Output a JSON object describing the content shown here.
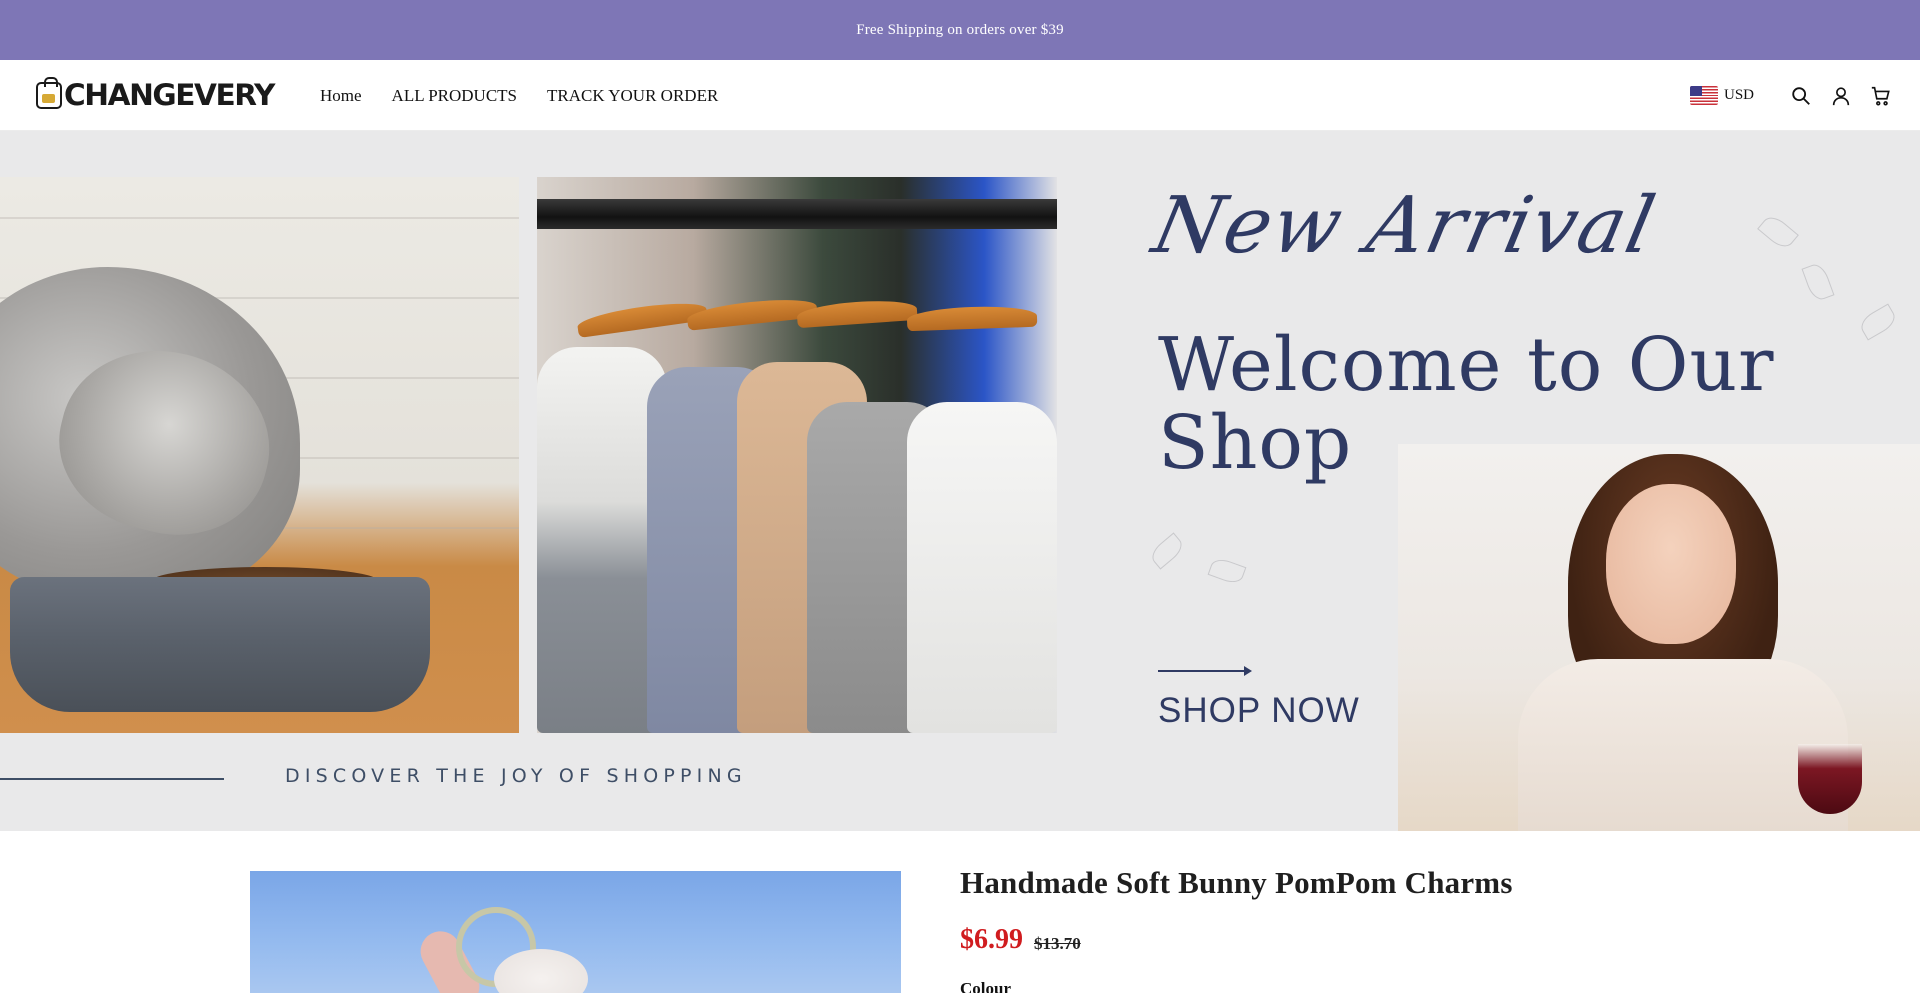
{
  "announcement": {
    "text": "Free Shipping on orders over $39"
  },
  "header": {
    "logo": "CHANGEVERY",
    "nav": [
      {
        "label": "Home"
      },
      {
        "label": "ALL PRODUCTS"
      },
      {
        "label": "TRACK YOUR ORDER"
      }
    ],
    "currency": {
      "code": "USD",
      "flag_icon": "us-flag-icon"
    },
    "icons": [
      "search-icon",
      "account-icon",
      "cart-icon"
    ]
  },
  "hero": {
    "script_heading": "New Arrival",
    "heading": "Welcome to Our Shop",
    "cta": "SHOP NOW",
    "tagline": "DISCOVER THE JOY OF SHOPPING",
    "accent_color": "#2f3a63"
  },
  "product": {
    "title": "Handmade Soft Bunny PomPom Charms",
    "price_current": "$6.99",
    "price_original": "$13.70",
    "option_label": "Colour",
    "price_color": "#d01c1f"
  },
  "colors": {
    "announcement_bg": "#7e76b6",
    "hero_bg": "#e9e9ea"
  }
}
